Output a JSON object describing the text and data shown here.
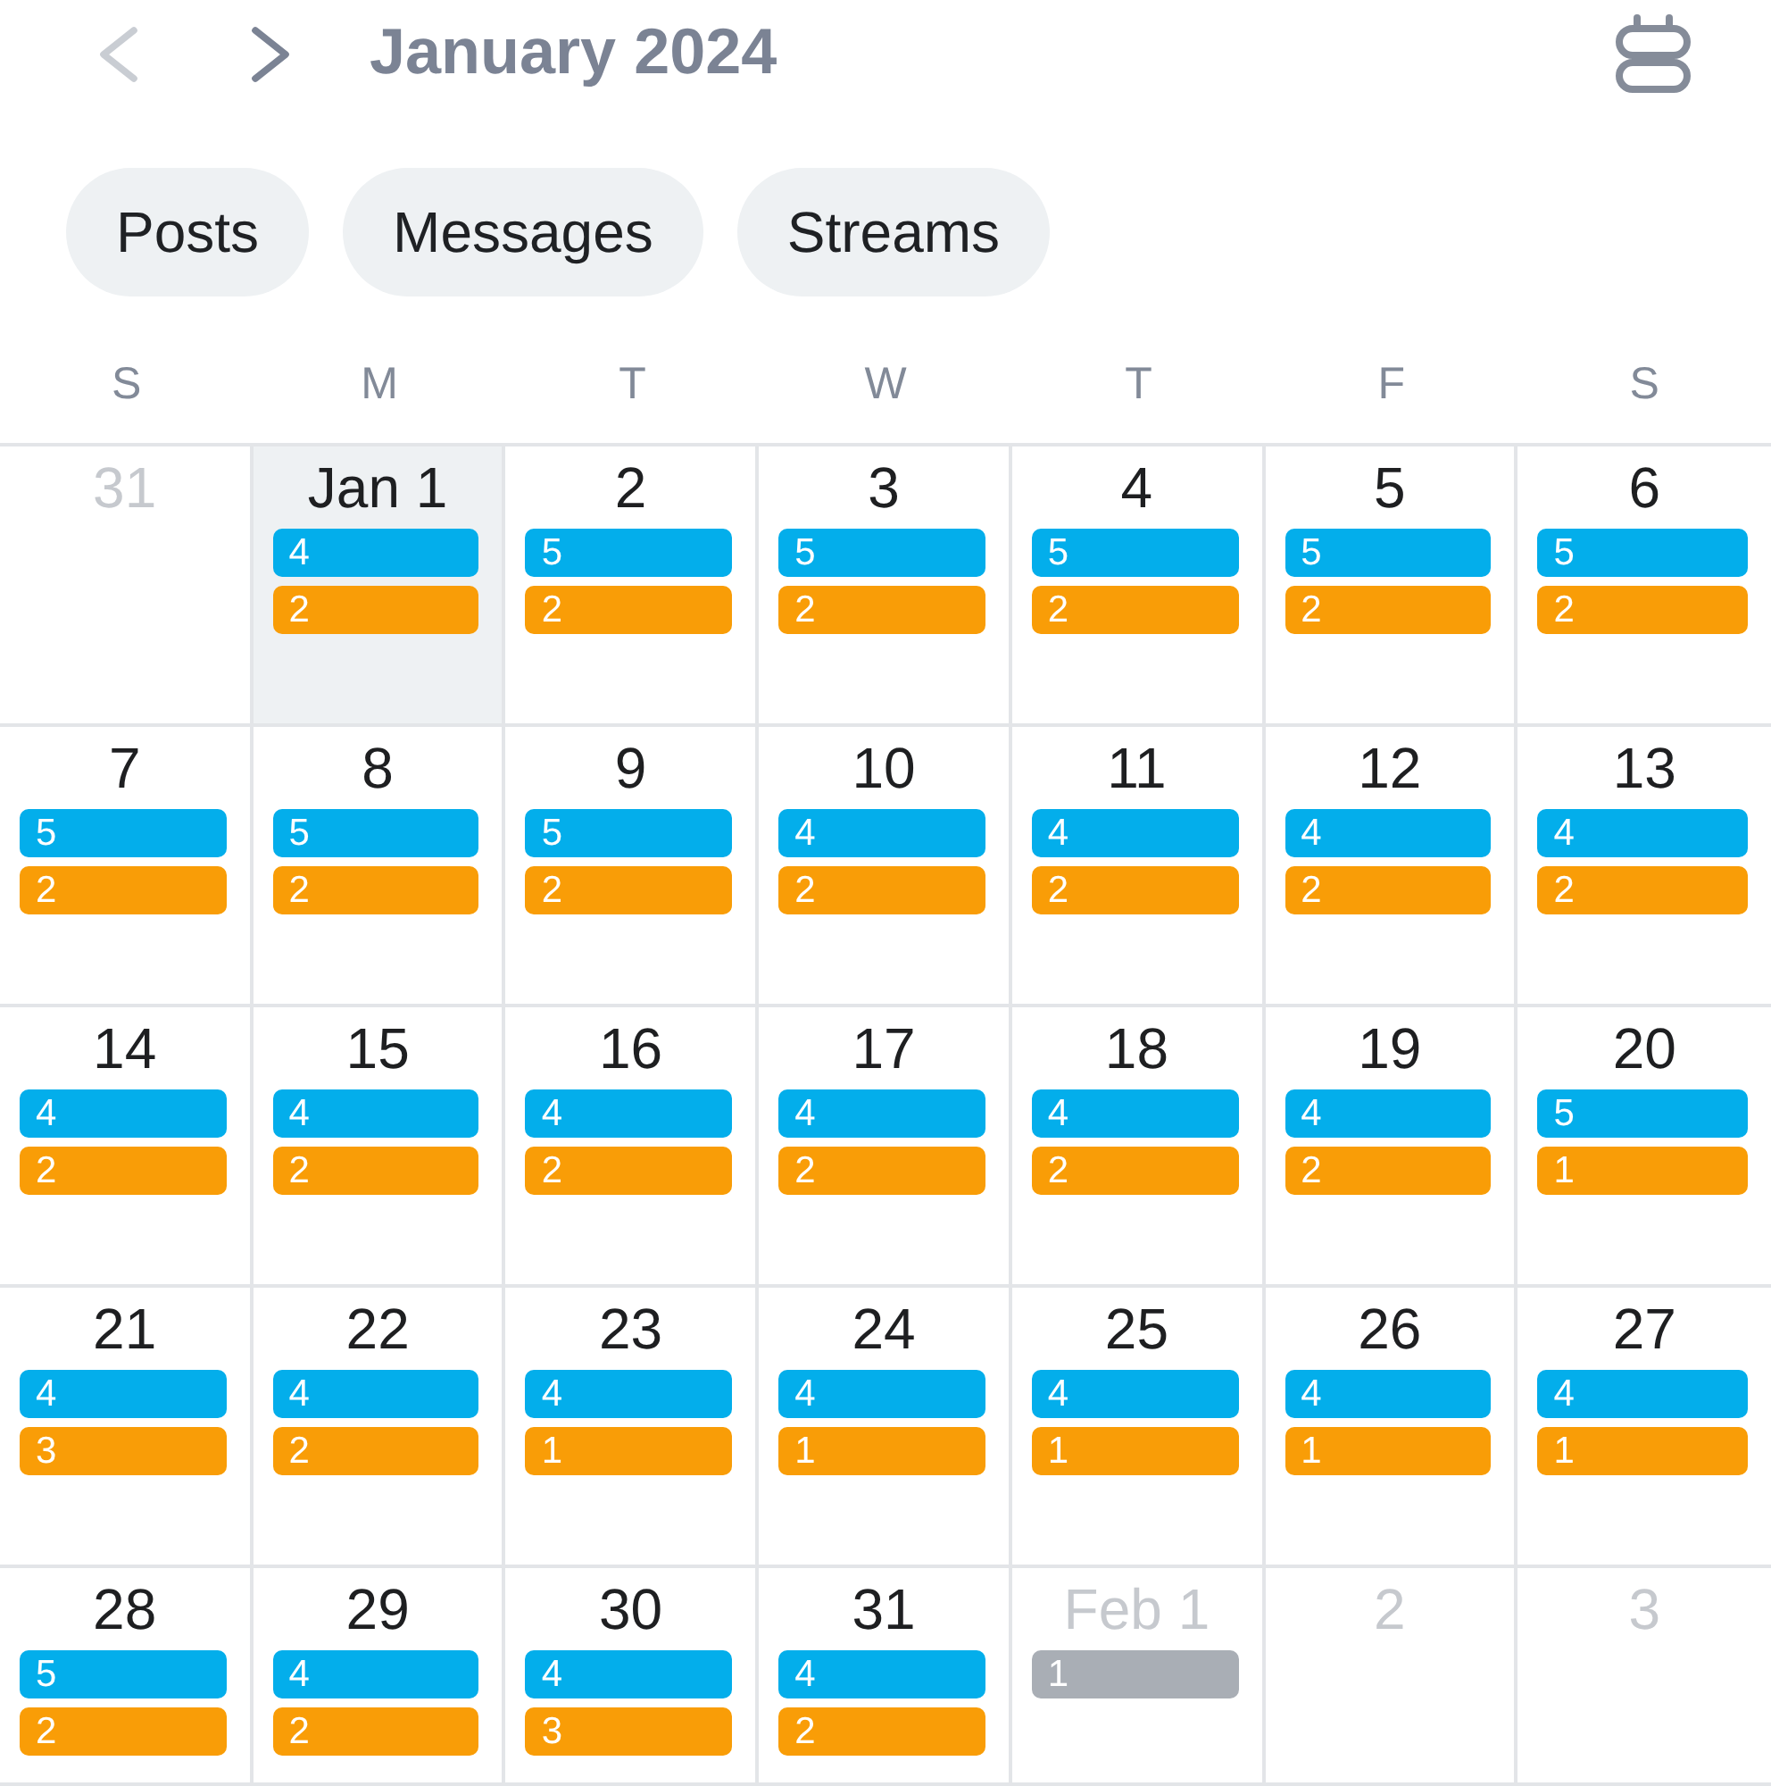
{
  "nav": [
    {
      "kind": "prev",
      "disabled": true
    },
    {
      "kind": "next",
      "disabled": false
    }
  ],
  "title": "January 2024",
  "filters": [
    {
      "label": "Posts",
      "selected": false
    },
    {
      "label": "Messages",
      "selected": false
    },
    {
      "label": "Streams",
      "selected": false
    }
  ],
  "weekdays": [
    "S",
    "M",
    "T",
    "W",
    "T",
    "F",
    "S"
  ],
  "weeks": [
    [
      {
        "day": "31",
        "in_month": false,
        "selected": false
      },
      {
        "day": "Jan 1",
        "in_month": true,
        "selected": true,
        "events": [
          {
            "count": "4",
            "color": "#03aeeb"
          },
          {
            "count": "2",
            "color": "#f99d07"
          }
        ]
      },
      {
        "day": "2",
        "in_month": true,
        "selected": false,
        "events": [
          {
            "count": "5",
            "color": "#03aeeb"
          },
          {
            "count": "2",
            "color": "#f99d07"
          }
        ]
      },
      {
        "day": "3",
        "in_month": true,
        "selected": false,
        "events": [
          {
            "count": "5",
            "color": "#03aeeb"
          },
          {
            "count": "2",
            "color": "#f99d07"
          }
        ]
      },
      {
        "day": "4",
        "in_month": true,
        "selected": false,
        "events": [
          {
            "count": "5",
            "color": "#03aeeb"
          },
          {
            "count": "2",
            "color": "#f99d07"
          }
        ]
      },
      {
        "day": "5",
        "in_month": true,
        "selected": false,
        "events": [
          {
            "count": "5",
            "color": "#03aeeb"
          },
          {
            "count": "2",
            "color": "#f99d07"
          }
        ]
      },
      {
        "day": "6",
        "in_month": true,
        "selected": false,
        "events": [
          {
            "count": "5",
            "color": "#03aeeb"
          },
          {
            "count": "2",
            "color": "#f99d07"
          }
        ]
      }
    ],
    [
      {
        "day": "7",
        "in_month": true,
        "selected": false,
        "events": [
          {
            "count": "5",
            "color": "#03aeeb"
          },
          {
            "count": "2",
            "color": "#f99d07"
          }
        ]
      },
      {
        "day": "8",
        "in_month": true,
        "selected": false,
        "events": [
          {
            "count": "5",
            "color": "#03aeeb"
          },
          {
            "count": "2",
            "color": "#f99d07"
          }
        ]
      },
      {
        "day": "9",
        "in_month": true,
        "selected": false,
        "events": [
          {
            "count": "5",
            "color": "#03aeeb"
          },
          {
            "count": "2",
            "color": "#f99d07"
          }
        ]
      },
      {
        "day": "10",
        "in_month": true,
        "selected": false,
        "events": [
          {
            "count": "4",
            "color": "#03aeeb"
          },
          {
            "count": "2",
            "color": "#f99d07"
          }
        ]
      },
      {
        "day": "11",
        "in_month": true,
        "selected": false,
        "events": [
          {
            "count": "4",
            "color": "#03aeeb"
          },
          {
            "count": "2",
            "color": "#f99d07"
          }
        ]
      },
      {
        "day": "12",
        "in_month": true,
        "selected": false,
        "events": [
          {
            "count": "4",
            "color": "#03aeeb"
          },
          {
            "count": "2",
            "color": "#f99d07"
          }
        ]
      },
      {
        "day": "13",
        "in_month": true,
        "selected": false,
        "events": [
          {
            "count": "4",
            "color": "#03aeeb"
          },
          {
            "count": "2",
            "color": "#f99d07"
          }
        ]
      }
    ],
    [
      {
        "day": "14",
        "in_month": true,
        "selected": false,
        "events": [
          {
            "count": "4",
            "color": "#03aeeb"
          },
          {
            "count": "2",
            "color": "#f99d07"
          }
        ]
      },
      {
        "day": "15",
        "in_month": true,
        "selected": false,
        "events": [
          {
            "count": "4",
            "color": "#03aeeb"
          },
          {
            "count": "2",
            "color": "#f99d07"
          }
        ]
      },
      {
        "day": "16",
        "in_month": true,
        "selected": false,
        "events": [
          {
            "count": "4",
            "color": "#03aeeb"
          },
          {
            "count": "2",
            "color": "#f99d07"
          }
        ]
      },
      {
        "day": "17",
        "in_month": true,
        "selected": false,
        "events": [
          {
            "count": "4",
            "color": "#03aeeb"
          },
          {
            "count": "2",
            "color": "#f99d07"
          }
        ]
      },
      {
        "day": "18",
        "in_month": true,
        "selected": false,
        "events": [
          {
            "count": "4",
            "color": "#03aeeb"
          },
          {
            "count": "2",
            "color": "#f99d07"
          }
        ]
      },
      {
        "day": "19",
        "in_month": true,
        "selected": false,
        "events": [
          {
            "count": "4",
            "color": "#03aeeb"
          },
          {
            "count": "2",
            "color": "#f99d07"
          }
        ]
      },
      {
        "day": "20",
        "in_month": true,
        "selected": false,
        "events": [
          {
            "count": "5",
            "color": "#03aeeb"
          },
          {
            "count": "1",
            "color": "#f99d07"
          }
        ]
      }
    ],
    [
      {
        "day": "21",
        "in_month": true,
        "selected": false,
        "events": [
          {
            "count": "4",
            "color": "#03aeeb"
          },
          {
            "count": "3",
            "color": "#f99d07"
          }
        ]
      },
      {
        "day": "22",
        "in_month": true,
        "selected": false,
        "events": [
          {
            "count": "4",
            "color": "#03aeeb"
          },
          {
            "count": "2",
            "color": "#f99d07"
          }
        ]
      },
      {
        "day": "23",
        "in_month": true,
        "selected": false,
        "events": [
          {
            "count": "4",
            "color": "#03aeeb"
          },
          {
            "count": "1",
            "color": "#f99d07"
          }
        ]
      },
      {
        "day": "24",
        "in_month": true,
        "selected": false,
        "events": [
          {
            "count": "4",
            "color": "#03aeeb"
          },
          {
            "count": "1",
            "color": "#f99d07"
          }
        ]
      },
      {
        "day": "25",
        "in_month": true,
        "selected": false,
        "events": [
          {
            "count": "4",
            "color": "#03aeeb"
          },
          {
            "count": "1",
            "color": "#f99d07"
          }
        ]
      },
      {
        "day": "26",
        "in_month": true,
        "selected": false,
        "events": [
          {
            "count": "4",
            "color": "#03aeeb"
          },
          {
            "count": "1",
            "color": "#f99d07"
          }
        ]
      },
      {
        "day": "27",
        "in_month": true,
        "selected": false,
        "events": [
          {
            "count": "4",
            "color": "#03aeeb"
          },
          {
            "count": "1",
            "color": "#f99d07"
          }
        ]
      }
    ],
    [
      {
        "day": "28",
        "in_month": true,
        "selected": false,
        "events": [
          {
            "count": "5",
            "color": "#03aeeb"
          },
          {
            "count": "2",
            "color": "#f99d07"
          }
        ]
      },
      {
        "day": "29",
        "in_month": true,
        "selected": false,
        "events": [
          {
            "count": "4",
            "color": "#03aeeb"
          },
          {
            "count": "2",
            "color": "#f99d07"
          }
        ]
      },
      {
        "day": "30",
        "in_month": true,
        "selected": false,
        "events": [
          {
            "count": "4",
            "color": "#03aeeb"
          },
          {
            "count": "3",
            "color": "#f99d07"
          }
        ]
      },
      {
        "day": "31",
        "in_month": true,
        "selected": false,
        "events": [
          {
            "count": "4",
            "color": "#03aeeb"
          },
          {
            "count": "2",
            "color": "#f99d07"
          }
        ]
      },
      {
        "day": "Feb 1",
        "in_month": false,
        "selected": false,
        "events": [
          {
            "count": "1",
            "color": "#a9aeb5"
          }
        ]
      },
      {
        "day": "2",
        "in_month": false,
        "selected": false
      },
      {
        "day": "3",
        "in_month": false,
        "selected": false
      }
    ]
  ]
}
